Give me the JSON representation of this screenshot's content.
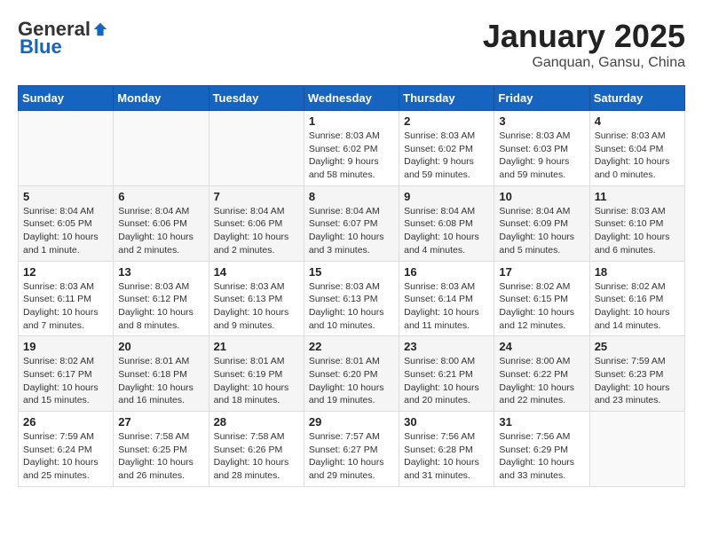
{
  "logo": {
    "general": "General",
    "blue": "Blue"
  },
  "header": {
    "month": "January 2025",
    "location": "Ganquan, Gansu, China"
  },
  "weekdays": [
    "Sunday",
    "Monday",
    "Tuesday",
    "Wednesday",
    "Thursday",
    "Friday",
    "Saturday"
  ],
  "weeks": [
    [
      {
        "day": "",
        "info": ""
      },
      {
        "day": "",
        "info": ""
      },
      {
        "day": "",
        "info": ""
      },
      {
        "day": "1",
        "info": "Sunrise: 8:03 AM\nSunset: 6:02 PM\nDaylight: 9 hours and 58 minutes."
      },
      {
        "day": "2",
        "info": "Sunrise: 8:03 AM\nSunset: 6:02 PM\nDaylight: 9 hours and 59 minutes."
      },
      {
        "day": "3",
        "info": "Sunrise: 8:03 AM\nSunset: 6:03 PM\nDaylight: 9 hours and 59 minutes."
      },
      {
        "day": "4",
        "info": "Sunrise: 8:03 AM\nSunset: 6:04 PM\nDaylight: 10 hours and 0 minutes."
      }
    ],
    [
      {
        "day": "5",
        "info": "Sunrise: 8:04 AM\nSunset: 6:05 PM\nDaylight: 10 hours and 1 minute."
      },
      {
        "day": "6",
        "info": "Sunrise: 8:04 AM\nSunset: 6:06 PM\nDaylight: 10 hours and 2 minutes."
      },
      {
        "day": "7",
        "info": "Sunrise: 8:04 AM\nSunset: 6:06 PM\nDaylight: 10 hours and 2 minutes."
      },
      {
        "day": "8",
        "info": "Sunrise: 8:04 AM\nSunset: 6:07 PM\nDaylight: 10 hours and 3 minutes."
      },
      {
        "day": "9",
        "info": "Sunrise: 8:04 AM\nSunset: 6:08 PM\nDaylight: 10 hours and 4 minutes."
      },
      {
        "day": "10",
        "info": "Sunrise: 8:04 AM\nSunset: 6:09 PM\nDaylight: 10 hours and 5 minutes."
      },
      {
        "day": "11",
        "info": "Sunrise: 8:03 AM\nSunset: 6:10 PM\nDaylight: 10 hours and 6 minutes."
      }
    ],
    [
      {
        "day": "12",
        "info": "Sunrise: 8:03 AM\nSunset: 6:11 PM\nDaylight: 10 hours and 7 minutes."
      },
      {
        "day": "13",
        "info": "Sunrise: 8:03 AM\nSunset: 6:12 PM\nDaylight: 10 hours and 8 minutes."
      },
      {
        "day": "14",
        "info": "Sunrise: 8:03 AM\nSunset: 6:13 PM\nDaylight: 10 hours and 9 minutes."
      },
      {
        "day": "15",
        "info": "Sunrise: 8:03 AM\nSunset: 6:13 PM\nDaylight: 10 hours and 10 minutes."
      },
      {
        "day": "16",
        "info": "Sunrise: 8:03 AM\nSunset: 6:14 PM\nDaylight: 10 hours and 11 minutes."
      },
      {
        "day": "17",
        "info": "Sunrise: 8:02 AM\nSunset: 6:15 PM\nDaylight: 10 hours and 12 minutes."
      },
      {
        "day": "18",
        "info": "Sunrise: 8:02 AM\nSunset: 6:16 PM\nDaylight: 10 hours and 14 minutes."
      }
    ],
    [
      {
        "day": "19",
        "info": "Sunrise: 8:02 AM\nSunset: 6:17 PM\nDaylight: 10 hours and 15 minutes."
      },
      {
        "day": "20",
        "info": "Sunrise: 8:01 AM\nSunset: 6:18 PM\nDaylight: 10 hours and 16 minutes."
      },
      {
        "day": "21",
        "info": "Sunrise: 8:01 AM\nSunset: 6:19 PM\nDaylight: 10 hours and 18 minutes."
      },
      {
        "day": "22",
        "info": "Sunrise: 8:01 AM\nSunset: 6:20 PM\nDaylight: 10 hours and 19 minutes."
      },
      {
        "day": "23",
        "info": "Sunrise: 8:00 AM\nSunset: 6:21 PM\nDaylight: 10 hours and 20 minutes."
      },
      {
        "day": "24",
        "info": "Sunrise: 8:00 AM\nSunset: 6:22 PM\nDaylight: 10 hours and 22 minutes."
      },
      {
        "day": "25",
        "info": "Sunrise: 7:59 AM\nSunset: 6:23 PM\nDaylight: 10 hours and 23 minutes."
      }
    ],
    [
      {
        "day": "26",
        "info": "Sunrise: 7:59 AM\nSunset: 6:24 PM\nDaylight: 10 hours and 25 minutes."
      },
      {
        "day": "27",
        "info": "Sunrise: 7:58 AM\nSunset: 6:25 PM\nDaylight: 10 hours and 26 minutes."
      },
      {
        "day": "28",
        "info": "Sunrise: 7:58 AM\nSunset: 6:26 PM\nDaylight: 10 hours and 28 minutes."
      },
      {
        "day": "29",
        "info": "Sunrise: 7:57 AM\nSunset: 6:27 PM\nDaylight: 10 hours and 29 minutes."
      },
      {
        "day": "30",
        "info": "Sunrise: 7:56 AM\nSunset: 6:28 PM\nDaylight: 10 hours and 31 minutes."
      },
      {
        "day": "31",
        "info": "Sunrise: 7:56 AM\nSunset: 6:29 PM\nDaylight: 10 hours and 33 minutes."
      },
      {
        "day": "",
        "info": ""
      }
    ]
  ]
}
